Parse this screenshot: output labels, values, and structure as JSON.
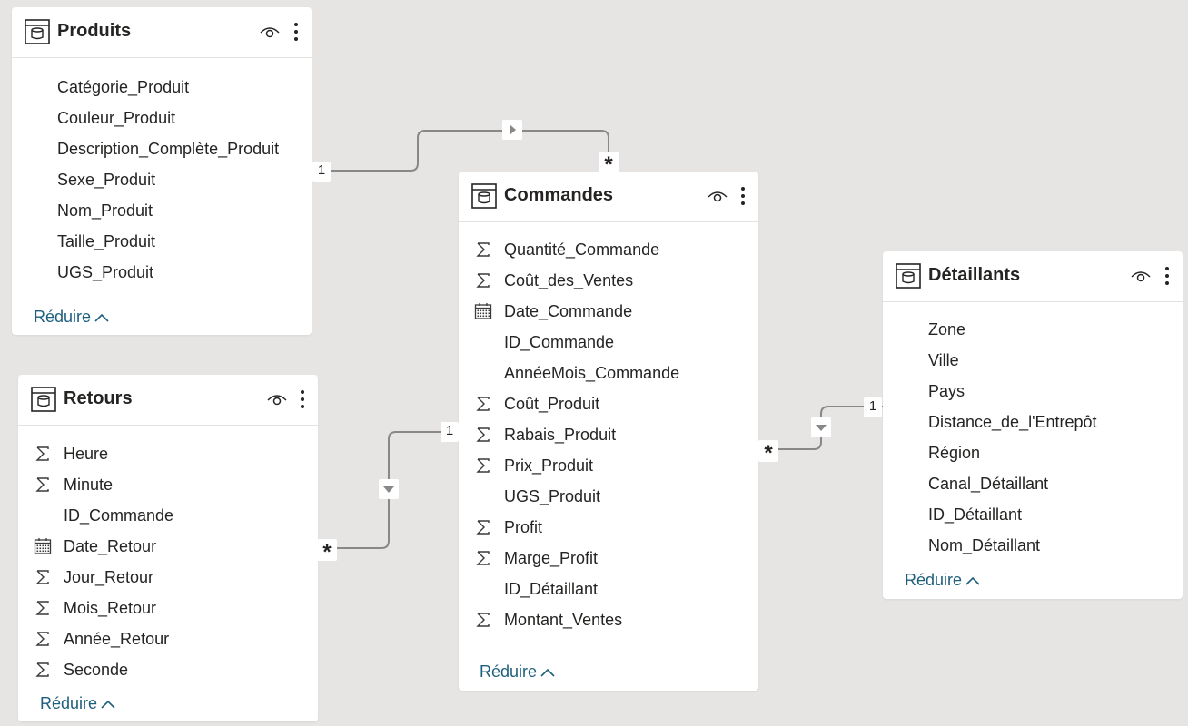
{
  "tables": {
    "produits": {
      "title": "Produits",
      "fields": [
        {
          "name": "Catégorie_Produit",
          "icon": "none"
        },
        {
          "name": "Couleur_Produit",
          "icon": "none"
        },
        {
          "name": "Description_Complète_Produit",
          "icon": "none"
        },
        {
          "name": "Sexe_Produit",
          "icon": "none"
        },
        {
          "name": "Nom_Produit",
          "icon": "none"
        },
        {
          "name": "Taille_Produit",
          "icon": "none"
        },
        {
          "name": "UGS_Produit",
          "icon": "none"
        }
      ],
      "collapse_label": "Réduire"
    },
    "commandes": {
      "title": "Commandes",
      "fields": [
        {
          "name": "Quantité_Commande",
          "icon": "sigma-icon"
        },
        {
          "name": "Coût_des_Ventes",
          "icon": "sigma-icon"
        },
        {
          "name": "Date_Commande",
          "icon": "calendar-icon"
        },
        {
          "name": "ID_Commande",
          "icon": "none"
        },
        {
          "name": "AnnéeMois_Commande",
          "icon": "none"
        },
        {
          "name": "Coût_Produit",
          "icon": "sigma-icon"
        },
        {
          "name": "Rabais_Produit",
          "icon": "sigma-icon"
        },
        {
          "name": "Prix_Produit",
          "icon": "sigma-icon"
        },
        {
          "name": "UGS_Produit",
          "icon": "none"
        },
        {
          "name": "Profit",
          "icon": "sigma-icon"
        },
        {
          "name": "Marge_Profit",
          "icon": "sigma-icon"
        },
        {
          "name": "ID_Détaillant",
          "icon": "none"
        },
        {
          "name": "Montant_Ventes",
          "icon": "sigma-icon"
        }
      ],
      "collapse_label": "Réduire"
    },
    "retours": {
      "title": "Retours",
      "fields": [
        {
          "name": "Heure",
          "icon": "sigma-icon"
        },
        {
          "name": "Minute",
          "icon": "sigma-icon"
        },
        {
          "name": "ID_Commande",
          "icon": "none"
        },
        {
          "name": "Date_Retour",
          "icon": "calendar-icon"
        },
        {
          "name": "Jour_Retour",
          "icon": "sigma-icon"
        },
        {
          "name": "Mois_Retour",
          "icon": "sigma-icon"
        },
        {
          "name": "Année_Retour",
          "icon": "sigma-icon"
        },
        {
          "name": "Seconde",
          "icon": "sigma-icon"
        }
      ],
      "collapse_label": "Réduire"
    },
    "detaillants": {
      "title": "Détaillants",
      "fields": [
        {
          "name": "Zone",
          "icon": "none"
        },
        {
          "name": "Ville",
          "icon": "none"
        },
        {
          "name": "Pays",
          "icon": "none"
        },
        {
          "name": "Distance_de_l'Entrepôt",
          "icon": "none"
        },
        {
          "name": "Région",
          "icon": "none"
        },
        {
          "name": "Canal_Détaillant",
          "icon": "none"
        },
        {
          "name": "ID_Détaillant",
          "icon": "none"
        },
        {
          "name": "Nom_Détaillant",
          "icon": "none"
        }
      ],
      "collapse_label": "Réduire"
    }
  },
  "relationships": [
    {
      "from": "Produits",
      "to": "Commandes",
      "from_cardinality": "1",
      "to_cardinality": "*",
      "direction": "single"
    },
    {
      "from": "Retours",
      "to": "Commandes",
      "from_cardinality": "*",
      "to_cardinality": "1",
      "direction": "single"
    },
    {
      "from": "Commandes",
      "to": "Détaillants",
      "from_cardinality": "*",
      "to_cardinality": "1",
      "direction": "single"
    }
  ],
  "colors": {
    "canvas_bg": "#e6e5e3",
    "card_bg": "#ffffff",
    "link_text": "#1e5f7e",
    "relationship_line": "#8a8886",
    "text": "#252423"
  }
}
